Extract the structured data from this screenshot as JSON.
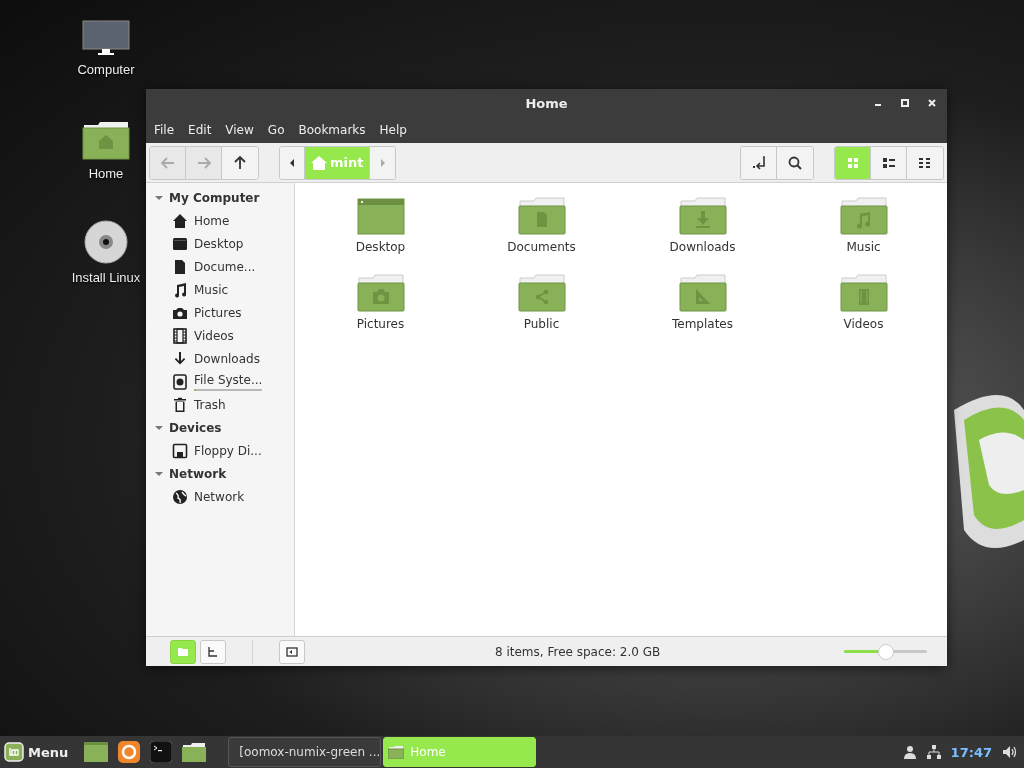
{
  "desktop_icons": [
    {
      "label": "Computer",
      "kind": "computer"
    },
    {
      "label": "Home",
      "kind": "home"
    },
    {
      "label": "Install Linux",
      "kind": "disc"
    }
  ],
  "window": {
    "title": "Home",
    "menu": [
      "File",
      "Edit",
      "View",
      "Go",
      "Bookmarks",
      "Help"
    ],
    "nav_buttons": [
      {
        "kind": "back",
        "disabled": true
      },
      {
        "kind": "forward",
        "disabled": true
      },
      {
        "kind": "up",
        "disabled": false
      }
    ],
    "path": {
      "label": "mint",
      "selected": true
    },
    "tool_buttons": [
      {
        "kind": "location"
      },
      {
        "kind": "search"
      }
    ],
    "view_buttons": [
      {
        "kind": "icons",
        "selected": true
      },
      {
        "kind": "list",
        "selected": false
      },
      {
        "kind": "compact",
        "selected": false
      }
    ],
    "sidebar": {
      "sections": [
        {
          "title": "My Computer",
          "expanded": true,
          "items": [
            {
              "label": "Home",
              "kind": "home"
            },
            {
              "label": "Desktop",
              "kind": "desktop"
            },
            {
              "label": "Docume...",
              "kind": "document"
            },
            {
              "label": "Music",
              "kind": "music"
            },
            {
              "label": "Pictures",
              "kind": "pictures"
            },
            {
              "label": "Videos",
              "kind": "videos"
            },
            {
              "label": "Downloads",
              "kind": "downloads"
            },
            {
              "label": "File Syste...",
              "kind": "drive",
              "level": 0.03
            },
            {
              "label": "Trash",
              "kind": "trash"
            }
          ]
        },
        {
          "title": "Devices",
          "expanded": true,
          "items": [
            {
              "label": "Floppy Di...",
              "kind": "floppy"
            }
          ]
        },
        {
          "title": "Network",
          "expanded": true,
          "items": [
            {
              "label": "Network",
              "kind": "network"
            }
          ]
        }
      ]
    },
    "files": [
      {
        "label": "Desktop",
        "kind": "desktop"
      },
      {
        "label": "Documents",
        "kind": "documents"
      },
      {
        "label": "Downloads",
        "kind": "downloads"
      },
      {
        "label": "Music",
        "kind": "music"
      },
      {
        "label": "Pictures",
        "kind": "pictures"
      },
      {
        "label": "Public",
        "kind": "public"
      },
      {
        "label": "Templates",
        "kind": "templates"
      },
      {
        "label": "Videos",
        "kind": "videos"
      }
    ],
    "status_bar": {
      "pane_buttons": [
        {
          "kind": "places",
          "selected": true
        },
        {
          "kind": "tree",
          "selected": false
        }
      ],
      "text": "8 items, Free space: 2.0 GB",
      "zoom": {
        "level": 0.5
      }
    }
  },
  "panel": {
    "menu_label": "Menu",
    "launchers": [
      {
        "kind": "show-desktop"
      },
      {
        "kind": "firefox"
      },
      {
        "kind": "terminal"
      },
      {
        "kind": "files"
      }
    ],
    "window_buttons": [
      {
        "label": "[oomox-numix-green ...",
        "kind": "firefox",
        "selected": false
      },
      {
        "label": "Home",
        "kind": "folder",
        "selected": true
      }
    ],
    "clock": "17:47"
  }
}
